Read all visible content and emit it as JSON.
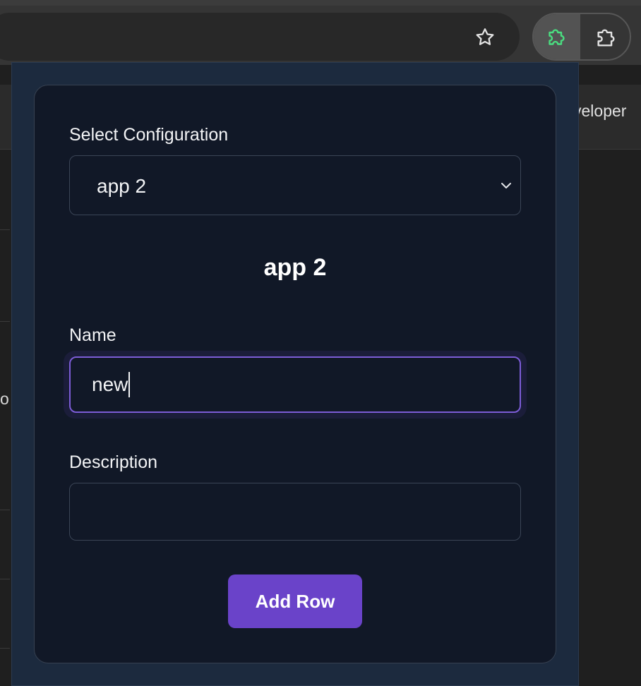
{
  "browser": {
    "icons": {
      "bookmark": "star-icon",
      "active_extension": "puzzle-icon",
      "extensions_menu": "puzzle-outline-icon"
    },
    "active_extension_color": "#4ade80"
  },
  "background_page": {
    "header_text_fragment": "veloper",
    "left_text_fragment": "ol"
  },
  "popup": {
    "select_label": "Select Configuration",
    "select_value": "app 2",
    "heading": "app 2",
    "name_label": "Name",
    "name_value": "new",
    "description_label": "Description",
    "description_value": "",
    "add_button_label": "Add Row",
    "colors": {
      "accent": "#6a43c9",
      "focus_border": "#7c5cd6",
      "card_bg": "#111827",
      "popup_bg": "#1c2a3e"
    }
  }
}
